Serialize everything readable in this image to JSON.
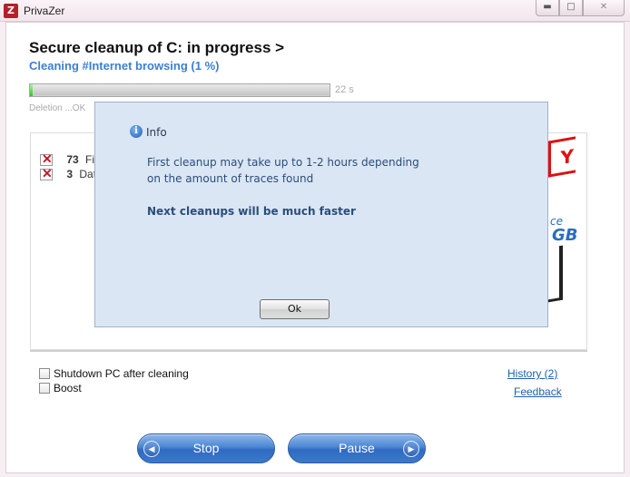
{
  "window": {
    "title": "PrivaZer",
    "app_icon_letter": "Z",
    "minimize_glyph": "▬",
    "maximize_glyph": "□",
    "close_glyph": "✕"
  },
  "main": {
    "title": "Secure cleanup of C: in progress  >",
    "subtitle": "Cleaning #Internet browsing (1 %)",
    "progress": {
      "percent": 1,
      "time_left": "22 s"
    },
    "deletion_status": "Deletion ...OK",
    "stats": [
      {
        "count": "73",
        "label": "Fi",
        "checked": true
      },
      {
        "count": "3",
        "label": "Dat",
        "checked": true
      }
    ],
    "promo": {
      "stamp": "Y",
      "text1": "ce",
      "text2": "GB"
    }
  },
  "options": {
    "shutdown_label": "Shutdown PC after cleaning",
    "shutdown_checked": false,
    "boost_label": "Boost",
    "boost_checked": false
  },
  "links": {
    "history": "History (2)",
    "feedback": "Feedback"
  },
  "actions": {
    "stop_label": "Stop",
    "pause_label": "Pause",
    "stop_arrow": "◀",
    "pause_arrow": "▶"
  },
  "dialog": {
    "icon": "i",
    "title": "Info",
    "line1": "First cleanup may take up to 1-2 hours depending",
    "line2": "on the amount of traces found",
    "line3": "Next cleanups will be much faster",
    "ok_label": "Ok"
  },
  "colors": {
    "accent": "#3c7fd0",
    "progress_green": "#36c229",
    "button_blue": "#3c79cc",
    "dialog_bg": "#dbe6f4"
  }
}
